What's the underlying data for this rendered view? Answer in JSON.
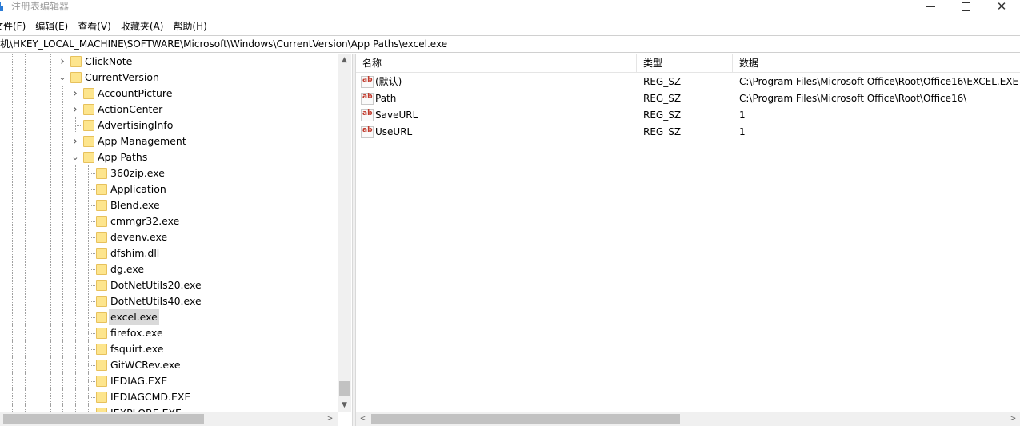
{
  "window": {
    "title": "注册表编辑器",
    "app_icon": "registry-editor-icon",
    "buttons": {
      "minimize": "minimize-icon",
      "maximize": "maximize-icon",
      "close": "close-icon",
      "close_glyph": "✕"
    }
  },
  "menu": [
    {
      "label": "文件(F)"
    },
    {
      "label": "编辑(E)"
    },
    {
      "label": "查看(V)"
    },
    {
      "label": "收藏夹(A)"
    },
    {
      "label": "帮助(H)"
    }
  ],
  "address": "计算机\\HKEY_LOCAL_MACHINE\\SOFTWARE\\Microsoft\\Windows\\CurrentVersion\\App Paths\\excel.exe",
  "tree": {
    "nodes": [
      {
        "label": "ClickNote",
        "depth": 0,
        "expander": "collapsed"
      },
      {
        "label": "CurrentVersion",
        "depth": 0,
        "expander": "expanded"
      },
      {
        "label": "AccountPicture",
        "depth": 1,
        "expander": "collapsed"
      },
      {
        "label": "ActionCenter",
        "depth": 1,
        "expander": "collapsed"
      },
      {
        "label": "AdvertisingInfo",
        "depth": 1,
        "expander": "none"
      },
      {
        "label": "App Management",
        "depth": 1,
        "expander": "collapsed"
      },
      {
        "label": "App Paths",
        "depth": 1,
        "expander": "expanded"
      },
      {
        "label": "360zip.exe",
        "depth": 2,
        "expander": "none"
      },
      {
        "label": "Application",
        "depth": 2,
        "expander": "none"
      },
      {
        "label": "Blend.exe",
        "depth": 2,
        "expander": "none"
      },
      {
        "label": "cmmgr32.exe",
        "depth": 2,
        "expander": "none"
      },
      {
        "label": "devenv.exe",
        "depth": 2,
        "expander": "none"
      },
      {
        "label": "dfshim.dll",
        "depth": 2,
        "expander": "none"
      },
      {
        "label": "dg.exe",
        "depth": 2,
        "expander": "none"
      },
      {
        "label": "DotNetUtils20.exe",
        "depth": 2,
        "expander": "none"
      },
      {
        "label": "DotNetUtils40.exe",
        "depth": 2,
        "expander": "none"
      },
      {
        "label": "excel.exe",
        "depth": 2,
        "expander": "none",
        "selected": true
      },
      {
        "label": "firefox.exe",
        "depth": 2,
        "expander": "none"
      },
      {
        "label": "fsquirt.exe",
        "depth": 2,
        "expander": "none"
      },
      {
        "label": "GitWCRev.exe",
        "depth": 2,
        "expander": "none"
      },
      {
        "label": "IEDIAG.EXE",
        "depth": 2,
        "expander": "none"
      },
      {
        "label": "IEDIAGCMD.EXE",
        "depth": 2,
        "expander": "none"
      },
      {
        "label": "IEXPLORE.EXE",
        "depth": 2,
        "expander": "none"
      }
    ]
  },
  "list": {
    "columns": [
      {
        "label": "名称"
      },
      {
        "label": "类型"
      },
      {
        "label": "数据"
      }
    ],
    "rows": [
      {
        "name": "(默认)",
        "type": "REG_SZ",
        "data": "C:\\Program Files\\Microsoft Office\\Root\\Office16\\EXCEL.EXE",
        "icon": "string-value-icon"
      },
      {
        "name": "Path",
        "type": "REG_SZ",
        "data": "C:\\Program Files\\Microsoft Office\\Root\\Office16\\",
        "icon": "string-value-icon"
      },
      {
        "name": "SaveURL",
        "type": "REG_SZ",
        "data": "1",
        "icon": "string-value-icon"
      },
      {
        "name": "UseURL",
        "type": "REG_SZ",
        "data": "1",
        "icon": "string-value-icon"
      }
    ],
    "value_icon_glyph": "ab"
  },
  "scrollbars": {
    "arrows": {
      "up": "▲",
      "down": "▼",
      "left": "<",
      "right": ">"
    }
  },
  "colors": {
    "folder": "#fde58d",
    "selection": "#d9d9d9",
    "scroll_thumb": "#c2c2c2",
    "value_icon_red": "#c0392b"
  }
}
